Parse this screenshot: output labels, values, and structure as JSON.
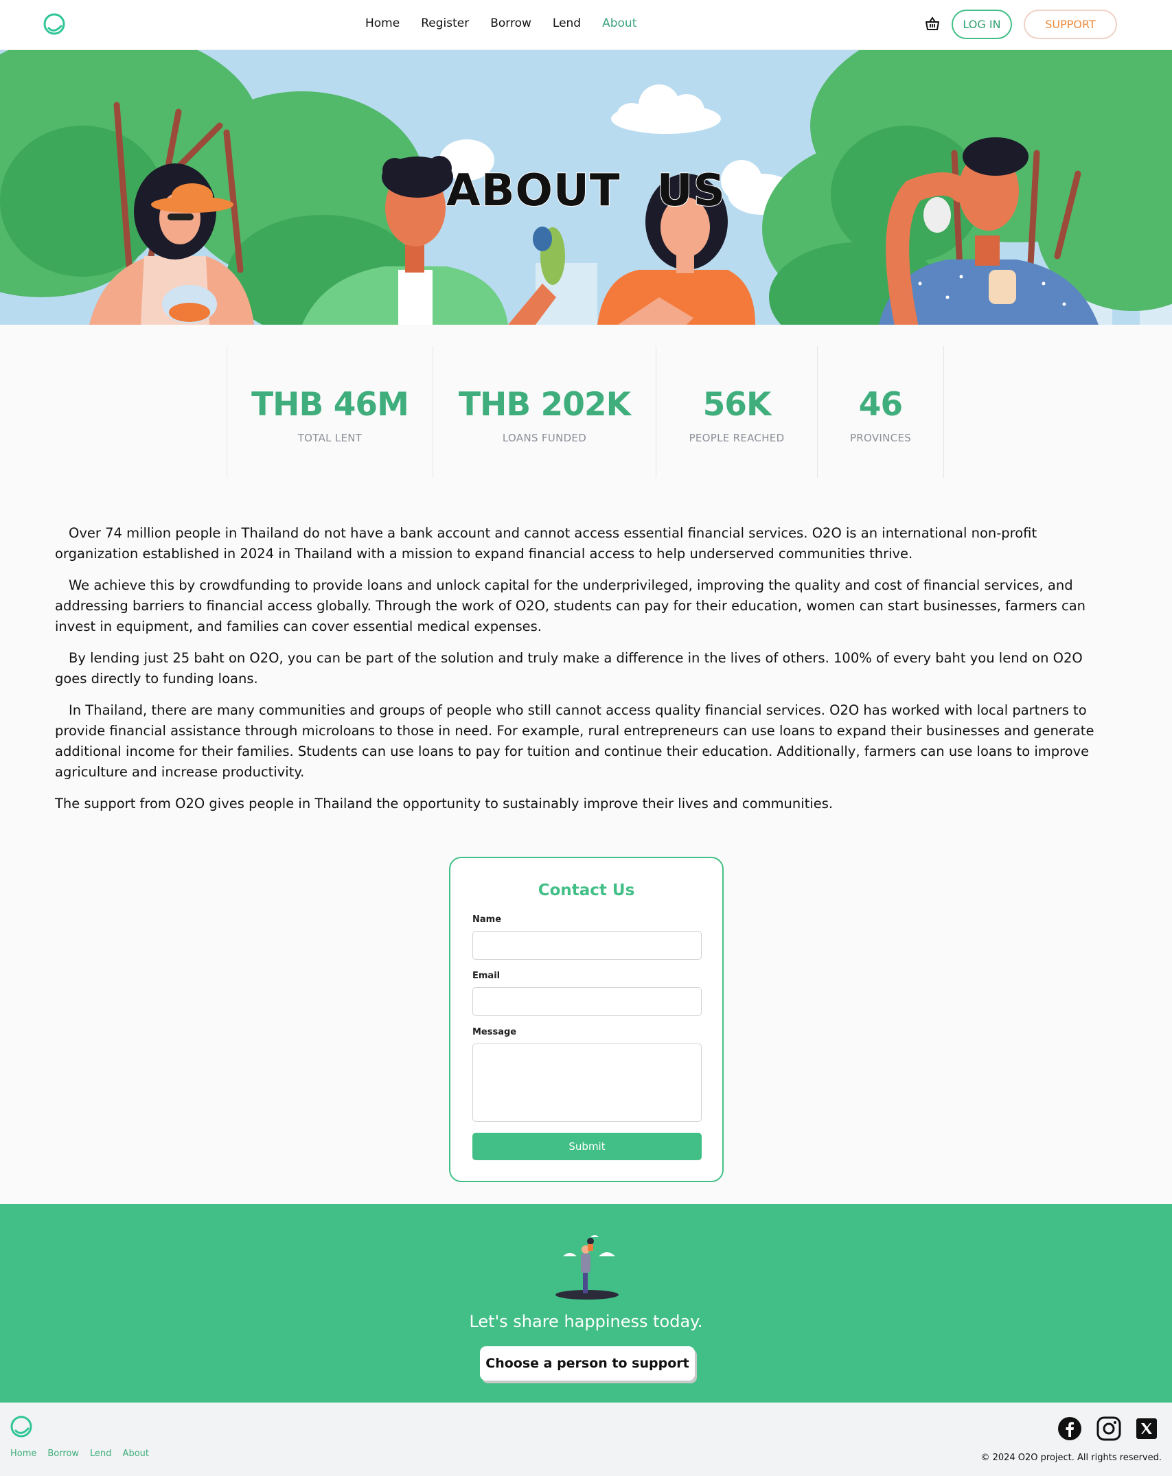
{
  "nav": {
    "links": [
      {
        "label": "Home",
        "active": false
      },
      {
        "label": "Register",
        "active": false
      },
      {
        "label": "Borrow",
        "active": false
      },
      {
        "label": "Lend",
        "active": false
      },
      {
        "label": "About",
        "active": true
      }
    ],
    "cart_icon": "basket-icon",
    "login_label": "LOG IN",
    "support_label": "SUPPORT"
  },
  "hero": {
    "title": "ABOUT US"
  },
  "stats": [
    {
      "value": "THB 46M",
      "label": "TOTAL LENT"
    },
    {
      "value": "THB 202K",
      "label": "LOANS FUNDED"
    },
    {
      "value": "56K",
      "label": "PEOPLE REACHED"
    },
    {
      "value": "46",
      "label": "PROVINCES"
    }
  ],
  "about": {
    "paragraphs": [
      "Over 74 million people in Thailand do not have a bank account and cannot access essential financial services. O2O is an international non-profit organization established in 2024 in Thailand with a mission to expand financial access to help underserved communities thrive.",
      "We achieve this by crowdfunding to provide loans and unlock capital for the underprivileged, improving the quality and cost of financial services, and addressing barriers to financial access globally. Through the work of O2O, students can pay for their education, women can start businesses, farmers can invest in equipment, and families can cover essential medical expenses.",
      "By lending just 25 baht on O2O, you can be part of the solution and truly make a difference in the lives of others. 100% of every baht you lend on O2O goes directly to funding loans.",
      "In Thailand, there are many communities and groups of people who still cannot access quality financial services. O2O has worked with local partners to provide financial assistance through microloans to those in need. For example, rural entrepreneurs can use loans to expand their businesses and generate additional income for their families. Students can use loans to pay for tuition and continue their education. Additionally, farmers can use loans to improve agriculture and increase productivity.",
      "The support from O2O gives people in Thailand the opportunity to sustainably improve their lives and communities."
    ]
  },
  "contact": {
    "title": "Contact Us",
    "name_label": "Name",
    "name_value": "",
    "email_label": "Email",
    "email_value": "",
    "message_label": "Message",
    "message_value": "",
    "submit_label": "Submit"
  },
  "cta": {
    "text": "Let's share happiness today.",
    "button_label": "Choose a person to support"
  },
  "footer": {
    "links": [
      "Home",
      "Borrow",
      "Lend",
      "About"
    ],
    "social_icons": [
      "facebook-icon",
      "instagram-icon",
      "x-icon"
    ],
    "copyright": "© 2024 O2O project. All rights reserved."
  },
  "colors": {
    "brand_green": "#42bf86",
    "support_orange": "#ee8a3a"
  }
}
